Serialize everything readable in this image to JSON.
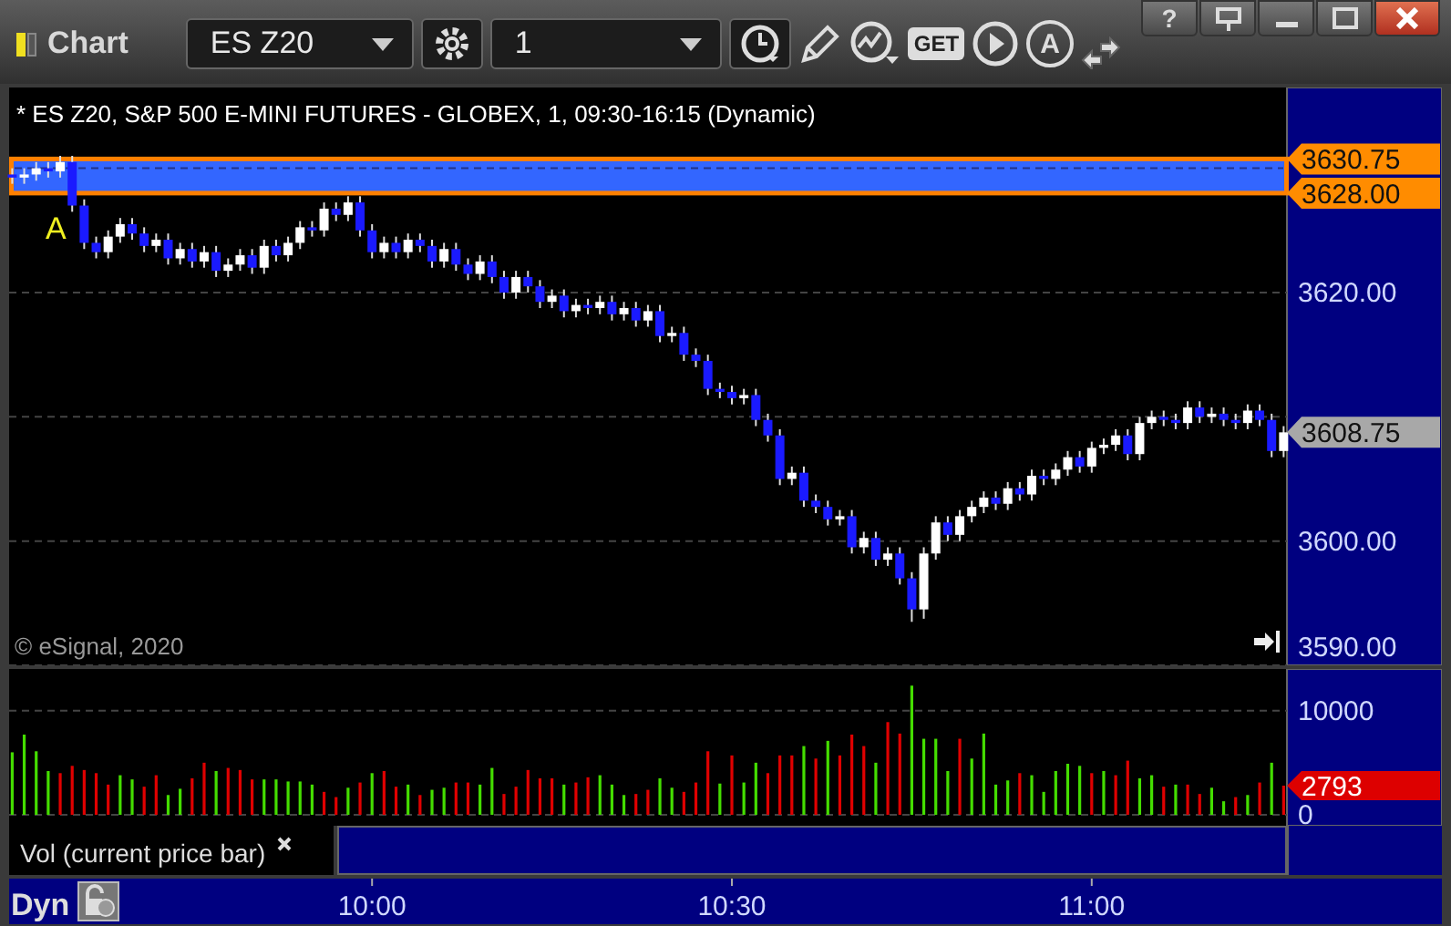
{
  "window": {
    "title": "Chart",
    "help_button": "?"
  },
  "toolbar": {
    "symbol_field": {
      "value": "ES Z20"
    },
    "interval_field": {
      "value": "1"
    },
    "get_button": "GET",
    "annotation_button": "A"
  },
  "price_panel": {
    "header": "* ES Z20, S&P 500 E-MINI FUTURES - GLOBEX, 1, 09:30-16:15 (Dynamic)",
    "marker_label": "A",
    "copyright": "© eSignal, 2020",
    "tags": [
      {
        "price": "3630.75",
        "color": "#ff8c00"
      },
      {
        "price": "3628.00",
        "color": "#ff8c00"
      },
      {
        "price": "3608.75",
        "color": "#a8a8a8"
      }
    ],
    "chart_data": {
      "type": "candlestick",
      "ylim": [
        3590,
        3636.5
      ],
      "yticks": [
        {
          "value": 3620,
          "label": "3620.00"
        },
        {
          "value": 3600,
          "label": "3600.00"
        },
        {
          "value": 3590,
          "label": "3590.00"
        }
      ],
      "ohlc": [
        [
          3629.5,
          3630,
          3628.75,
          3629.25
        ],
        [
          3629.25,
          3630,
          3628.75,
          3629.5
        ],
        [
          3629.5,
          3630.5,
          3629,
          3630
        ],
        [
          3630,
          3630.5,
          3629.25,
          3629.75
        ],
        [
          3629.75,
          3631,
          3629.25,
          3630.5
        ],
        [
          3630.5,
          3631,
          3626.5,
          3627
        ],
        [
          3627,
          3627.5,
          3623.5,
          3624
        ],
        [
          3624,
          3624.5,
          3622.75,
          3623.25
        ],
        [
          3623.25,
          3625,
          3622.75,
          3624.5
        ],
        [
          3624.5,
          3626,
          3624,
          3625.5
        ],
        [
          3625.5,
          3626,
          3624.25,
          3624.75
        ],
        [
          3624.75,
          3625.25,
          3623.25,
          3623.75
        ],
        [
          3623.75,
          3624.75,
          3623.25,
          3624.25
        ],
        [
          3624.25,
          3624.75,
          3622.25,
          3622.75
        ],
        [
          3622.75,
          3624,
          3622.25,
          3623.5
        ],
        [
          3623.5,
          3624,
          3622,
          3622.5
        ],
        [
          3622.5,
          3623.75,
          3622,
          3623.25
        ],
        [
          3623.25,
          3623.75,
          3621.25,
          3621.75
        ],
        [
          3621.75,
          3622.75,
          3621.25,
          3622.25
        ],
        [
          3622.25,
          3623.5,
          3621.75,
          3623
        ],
        [
          3623,
          3623.5,
          3621.5,
          3622
        ],
        [
          3622,
          3624.25,
          3621.5,
          3623.75
        ],
        [
          3623.75,
          3624.25,
          3622.5,
          3623
        ],
        [
          3623,
          3624.5,
          3622.5,
          3624
        ],
        [
          3624,
          3625.75,
          3623.5,
          3625.25
        ],
        [
          3625.25,
          3625.75,
          3624.5,
          3625
        ],
        [
          3625,
          3627.25,
          3624.5,
          3626.75
        ],
        [
          3626.75,
          3627.25,
          3625.75,
          3626.25
        ],
        [
          3626.25,
          3627.75,
          3625.75,
          3627.25
        ],
        [
          3627.25,
          3627.75,
          3624.5,
          3625
        ],
        [
          3625,
          3625.5,
          3622.75,
          3623.25
        ],
        [
          3623.25,
          3624.5,
          3622.75,
          3624
        ],
        [
          3624,
          3624.5,
          3622.75,
          3623.25
        ],
        [
          3623.25,
          3624.75,
          3622.75,
          3624.25
        ],
        [
          3624.25,
          3624.75,
          3623.25,
          3623.75
        ],
        [
          3623.75,
          3624.25,
          3622,
          3622.5
        ],
        [
          3622.5,
          3624,
          3622,
          3623.5
        ],
        [
          3623.5,
          3624,
          3621.75,
          3622.25
        ],
        [
          3622.25,
          3622.75,
          3621,
          3621.5
        ],
        [
          3621.5,
          3623,
          3621,
          3622.5
        ],
        [
          3622.5,
          3623,
          3620.75,
          3621.25
        ],
        [
          3621.25,
          3621.75,
          3619.5,
          3620
        ],
        [
          3620,
          3621.75,
          3619.5,
          3621.25
        ],
        [
          3621.25,
          3621.75,
          3620,
          3620.5
        ],
        [
          3620.5,
          3621,
          3618.75,
          3619.25
        ],
        [
          3619.25,
          3620.25,
          3618.75,
          3619.75
        ],
        [
          3619.75,
          3620.25,
          3618,
          3618.5
        ],
        [
          3618.5,
          3619.5,
          3618,
          3619
        ],
        [
          3619,
          3619.5,
          3618.25,
          3618.75
        ],
        [
          3618.75,
          3619.75,
          3618.25,
          3619.25
        ],
        [
          3619.25,
          3619.75,
          3617.75,
          3618.25
        ],
        [
          3618.25,
          3619.25,
          3617.75,
          3618.75
        ],
        [
          3618.75,
          3619.25,
          3617.25,
          3617.75
        ],
        [
          3617.75,
          3619,
          3617.25,
          3618.5
        ],
        [
          3618.5,
          3619,
          3616,
          3616.5
        ],
        [
          3616.5,
          3617.25,
          3616,
          3616.75
        ],
        [
          3616.75,
          3617.25,
          3614.5,
          3615
        ],
        [
          3615,
          3615.5,
          3614,
          3614.5
        ],
        [
          3614.5,
          3615,
          3611.75,
          3612.25
        ],
        [
          3612.25,
          3612.75,
          3611.5,
          3612
        ],
        [
          3612,
          3612.5,
          3611,
          3611.5
        ],
        [
          3611.5,
          3612.25,
          3611,
          3611.75
        ],
        [
          3611.75,
          3612.25,
          3609.25,
          3609.75
        ],
        [
          3609.75,
          3610.25,
          3608,
          3608.5
        ],
        [
          3608.5,
          3609,
          3604.5,
          3605
        ],
        [
          3605,
          3606,
          3604.5,
          3605.5
        ],
        [
          3605.5,
          3606,
          3602.75,
          3603.25
        ],
        [
          3603.25,
          3603.75,
          3602.25,
          3602.75
        ],
        [
          3602.75,
          3603.25,
          3601.25,
          3601.75
        ],
        [
          3601.75,
          3602.5,
          3601.25,
          3602
        ],
        [
          3602,
          3602.5,
          3599,
          3599.5
        ],
        [
          3599.5,
          3600.75,
          3599,
          3600.25
        ],
        [
          3600.25,
          3600.75,
          3598,
          3598.5
        ],
        [
          3598.5,
          3599.5,
          3598,
          3599
        ],
        [
          3599,
          3599.5,
          3596.5,
          3597
        ],
        [
          3597,
          3597.5,
          3593.5,
          3594.5
        ],
        [
          3594.5,
          3599.5,
          3593.75,
          3599
        ],
        [
          3599,
          3602,
          3598.5,
          3601.5
        ],
        [
          3601.5,
          3602,
          3600,
          3600.5
        ],
        [
          3600.5,
          3602.5,
          3600,
          3602
        ],
        [
          3602,
          3603.25,
          3601.5,
          3602.75
        ],
        [
          3602.75,
          3604,
          3602.25,
          3603.5
        ],
        [
          3603.5,
          3604,
          3602.5,
          3603
        ],
        [
          3603,
          3604.75,
          3602.5,
          3604.25
        ],
        [
          3604.25,
          3604.75,
          3603.25,
          3603.75
        ],
        [
          3603.75,
          3605.75,
          3603.25,
          3605.25
        ],
        [
          3605.25,
          3605.75,
          3604.5,
          3605
        ],
        [
          3605,
          3606.25,
          3604.5,
          3605.75
        ],
        [
          3605.75,
          3607.25,
          3605.25,
          3606.75
        ],
        [
          3606.75,
          3607.25,
          3605.5,
          3606
        ],
        [
          3606,
          3608,
          3605.5,
          3607.5
        ],
        [
          3607.5,
          3608.25,
          3607,
          3607.75
        ],
        [
          3607.75,
          3609,
          3607.25,
          3608.5
        ],
        [
          3608.5,
          3609,
          3606.5,
          3607
        ],
        [
          3607,
          3610,
          3606.5,
          3609.5
        ],
        [
          3609.5,
          3610.5,
          3609,
          3610
        ],
        [
          3610,
          3610.5,
          3609.25,
          3609.75
        ],
        [
          3609.75,
          3610.25,
          3609,
          3609.5
        ],
        [
          3609.5,
          3611.25,
          3609,
          3610.75
        ],
        [
          3610.75,
          3611.25,
          3609.5,
          3610
        ],
        [
          3610,
          3610.75,
          3609.5,
          3610.25
        ],
        [
          3610.25,
          3610.75,
          3609.25,
          3609.75
        ],
        [
          3609.75,
          3610.25,
          3609,
          3609.5
        ],
        [
          3609.5,
          3611,
          3609,
          3610.5
        ],
        [
          3610.5,
          3611,
          3609.25,
          3609.75
        ],
        [
          3609.75,
          3610.25,
          3606.75,
          3607.25
        ],
        [
          3607.25,
          3609.25,
          3606.75,
          3608.75
        ]
      ]
    }
  },
  "volume_panel": {
    "legend": "Vol (current price bar)",
    "last_tag": {
      "text": "2793",
      "color": "#dd0000"
    },
    "chart_data": {
      "type": "bar",
      "stacked": true,
      "ylim": [
        0,
        14000
      ],
      "yticks": [
        0,
        10000
      ],
      "series": [
        {
          "color": "#44dd00",
          "values": [
            6000,
            7700,
            6100,
            4200,
            null,
            null,
            null,
            null,
            null,
            3800,
            3400,
            null,
            null,
            1900,
            2500,
            null,
            null,
            4200,
            null,
            null,
            null,
            3400,
            3400,
            3200,
            3200,
            2900,
            null,
            null,
            2600,
            null,
            4000,
            null,
            null,
            2900,
            null,
            2400,
            2600,
            null,
            null,
            2900,
            4500,
            null,
            null,
            null,
            null,
            null,
            2900,
            null,
            null,
            3800,
            2900,
            1900,
            null,
            null,
            3500,
            2600,
            null,
            null,
            null,
            3000,
            null,
            3100,
            5000,
            null,
            null,
            null,
            6600,
            null,
            7100,
            null,
            null,
            null,
            5000,
            null,
            null,
            12400,
            7300,
            7300,
            4200,
            null,
            5400,
            7800,
            2900,
            3300,
            null,
            3800,
            2200,
            4200,
            4900,
            4700,
            null,
            4200,
            null,
            null,
            3500,
            3800,
            null,
            2900,
            null,
            null,
            2600,
            1300,
            null,
            1900,
            null,
            5000,
            null
          ]
        },
        {
          "color": "#e00000",
          "values": [
            null,
            null,
            null,
            null,
            4000,
            4700,
            4300,
            4000,
            2900,
            null,
            null,
            2700,
            3800,
            null,
            null,
            3500,
            5000,
            null,
            4500,
            4300,
            3400,
            null,
            null,
            null,
            null,
            null,
            2200,
            1700,
            null,
            3100,
            null,
            4200,
            2700,
            null,
            1900,
            null,
            null,
            3100,
            3100,
            null,
            null,
            2000,
            2700,
            4300,
            3500,
            3500,
            null,
            3100,
            3600,
            null,
            null,
            null,
            2000,
            2400,
            null,
            null,
            2200,
            3100,
            6100,
            null,
            5700,
            null,
            null,
            4000,
            5700,
            5700,
            null,
            5400,
            null,
            5700,
            7700,
            6600,
            null,
            8900,
            7800,
            null,
            null,
            null,
            null,
            7300,
            null,
            null,
            null,
            null,
            4000,
            null,
            null,
            null,
            null,
            null,
            4000,
            null,
            3800,
            5200,
            null,
            null,
            2700,
            null,
            2900,
            2000,
            null,
            null,
            1700,
            null,
            3100,
            null,
            2800
          ]
        }
      ]
    }
  },
  "time_axis": {
    "mode": "Dyn",
    "labels": [
      "10:00",
      "10:30",
      "11:00"
    ]
  }
}
